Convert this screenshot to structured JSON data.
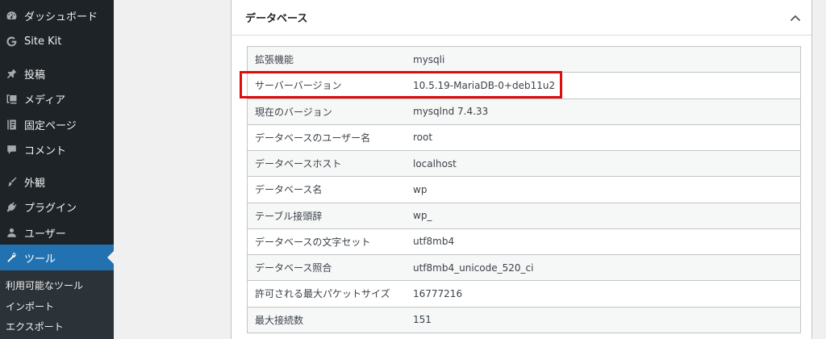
{
  "sidebar": {
    "items": [
      {
        "label": "ダッシュボード",
        "icon": "dashboard-icon"
      },
      {
        "label": "Site Kit",
        "icon": "google-g-icon"
      },
      {
        "label": "投稿",
        "icon": "pin-icon"
      },
      {
        "label": "メディア",
        "icon": "media-icon"
      },
      {
        "label": "固定ページ",
        "icon": "page-icon"
      },
      {
        "label": "コメント",
        "icon": "comment-icon"
      },
      {
        "label": "外観",
        "icon": "brush-icon"
      },
      {
        "label": "プラグイン",
        "icon": "plugin-icon"
      },
      {
        "label": "ユーザー",
        "icon": "user-icon"
      },
      {
        "label": "ツール",
        "icon": "wrench-icon"
      }
    ],
    "submenu": [
      "利用可能なツール",
      "インポート",
      "エクスポート"
    ]
  },
  "panel": {
    "title": "データベース",
    "rows": [
      {
        "key": "拡張機能",
        "value": "mysqli"
      },
      {
        "key": "サーバーバージョン",
        "value": "10.5.19-MariaDB-0+deb11u2"
      },
      {
        "key": "現在のバージョン",
        "value": "mysqlnd 7.4.33"
      },
      {
        "key": "データベースのユーザー名",
        "value": "root"
      },
      {
        "key": "データベースホスト",
        "value": "localhost"
      },
      {
        "key": "データベース名",
        "value": "wp"
      },
      {
        "key": "テーブル接頭辞",
        "value": "wp_"
      },
      {
        "key": "データベースの文字セット",
        "value": "utf8mb4"
      },
      {
        "key": "データベース照合",
        "value": "utf8mb4_unicode_520_ci"
      },
      {
        "key": "許可される最大パケットサイズ",
        "value": "16777216"
      },
      {
        "key": "最大接続数",
        "value": "151"
      }
    ]
  },
  "colors": {
    "sidebar_bg": "#1d2327",
    "active_bg": "#2271b1",
    "highlight": "#e00b0b"
  }
}
